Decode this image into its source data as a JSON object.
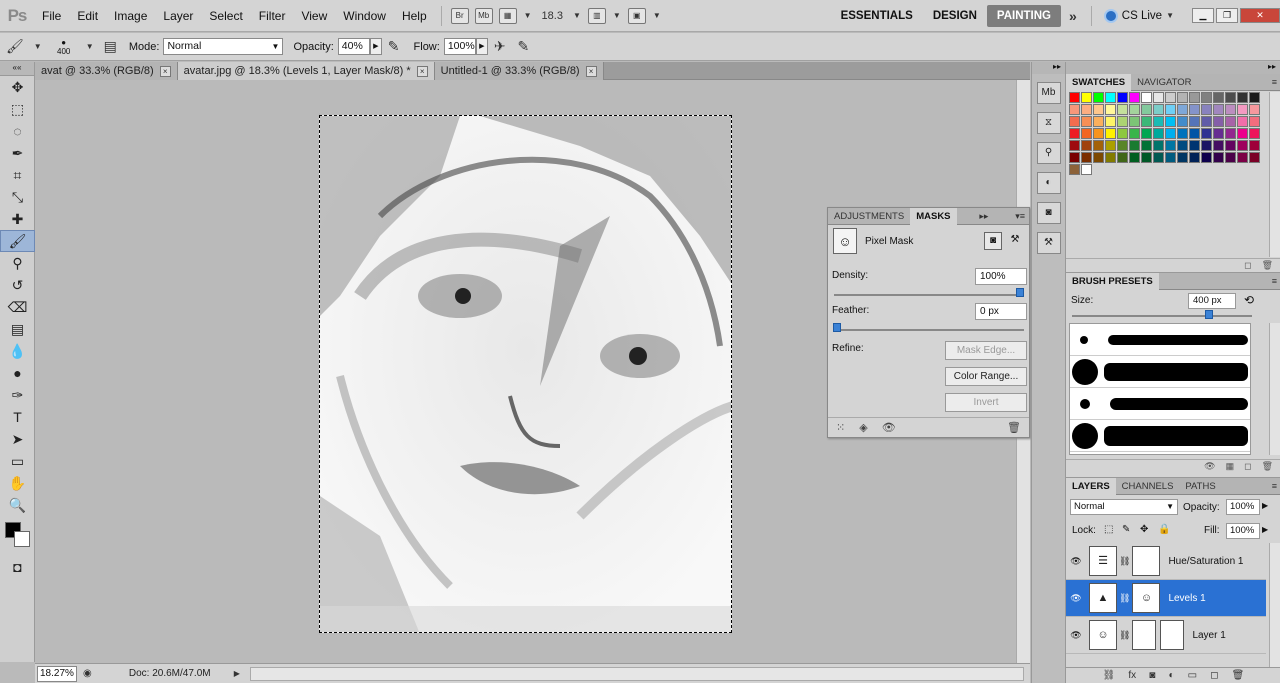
{
  "app": {
    "logo": "Ps"
  },
  "menu": [
    "File",
    "Edit",
    "Image",
    "Layer",
    "Select",
    "Filter",
    "View",
    "Window",
    "Help"
  ],
  "menubar_icons": {
    "bridge": "Br",
    "minibridge": "Mb"
  },
  "zoom_display": "18.3",
  "workspaces": {
    "essentials": "ESSENTIALS",
    "design": "DESIGN",
    "painting": "PAINTING",
    "more": "»"
  },
  "cs_live": "CS Live",
  "options": {
    "brush_size": "400",
    "mode_label": "Mode:",
    "mode_value": "Normal",
    "opacity_label": "Opacity:",
    "opacity_value": "40%",
    "flow_label": "Flow:",
    "flow_value": "100%"
  },
  "tabs": [
    {
      "label": "avat @ 33.3% (RGB/8)"
    },
    {
      "label": "avatar.jpg @ 18.3% (Levels 1, Layer Mask/8) *"
    },
    {
      "label": "Untitled-1 @ 33.3% (RGB/8)"
    }
  ],
  "status": {
    "zoom": "18.27%",
    "doc": "Doc: 20.6M/47.0M"
  },
  "masks_panel": {
    "tab_adjustments": "ADJUSTMENTS",
    "tab_masks": "MASKS",
    "pixel_mask": "Pixel Mask",
    "density_label": "Density:",
    "density_value": "100%",
    "feather_label": "Feather:",
    "feather_value": "0 px",
    "refine_label": "Refine:",
    "mask_edge": "Mask Edge...",
    "color_range": "Color Range...",
    "invert": "Invert"
  },
  "swatches_panel": {
    "tab_swatches": "SWATCHES",
    "tab_navigator": "NAVIGATOR"
  },
  "brush_presets": {
    "title": "BRUSH PRESETS",
    "size_label": "Size:",
    "size_value": "400 px"
  },
  "layers_panel": {
    "tab_layers": "LAYERS",
    "tab_channels": "CHANNELS",
    "tab_paths": "PATHS",
    "blend_mode": "Normal",
    "opacity_label": "Opacity:",
    "opacity_value": "100%",
    "lock_label": "Lock:",
    "fill_label": "Fill:",
    "fill_value": "100%",
    "layers": [
      {
        "name": "Hue/Saturation 1"
      },
      {
        "name": "Levels 1"
      },
      {
        "name": "Layer 1"
      }
    ]
  },
  "colors": {
    "accent": "#2a71d3",
    "active_workspace": "#7d7d7d"
  }
}
